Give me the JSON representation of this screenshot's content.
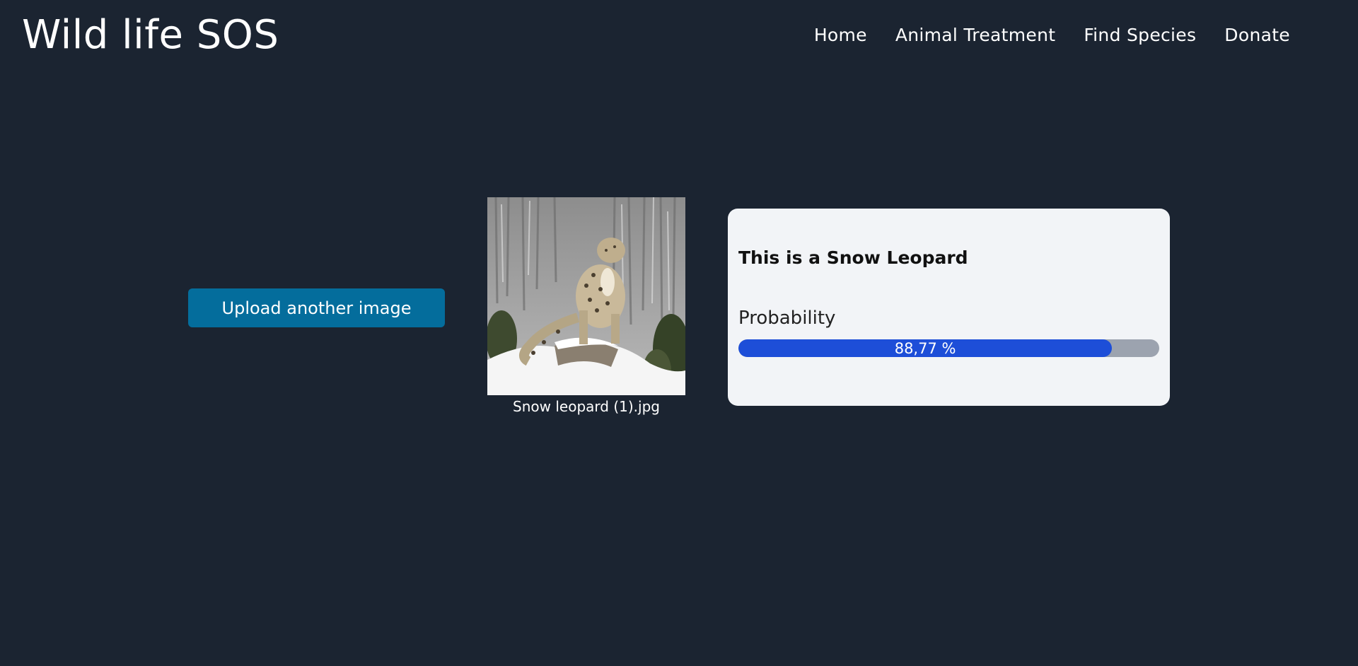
{
  "header": {
    "brand": "Wild life SOS",
    "nav": [
      {
        "label": "Home"
      },
      {
        "label": "Animal Treatment"
      },
      {
        "label": "Find Species"
      },
      {
        "label": "Donate"
      }
    ]
  },
  "upload": {
    "button_label": "Upload another image"
  },
  "preview": {
    "filename": "Snow leopard (1).jpg"
  },
  "result": {
    "title": "This is a Snow Leopard",
    "probability_label": "Probability",
    "probability_text": "88,77 %",
    "probability_fraction": 0.8877
  },
  "colors": {
    "background": "#1b2431",
    "button": "#046d9c",
    "card": "#f2f4f7",
    "bar_fill": "#1d4ed8",
    "bar_track": "#9ca3af"
  }
}
